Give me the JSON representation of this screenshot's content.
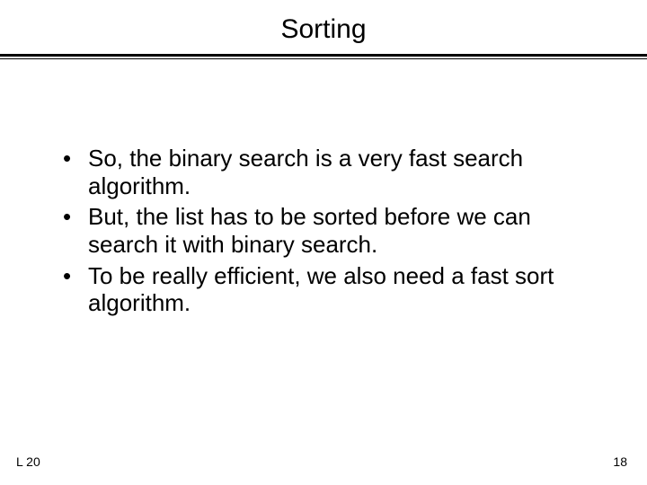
{
  "title": "Sorting",
  "bullets": [
    "So, the binary search is a very fast search algorithm.",
    "But, the list has to be sorted before we can search it with binary search.",
    "To be really efficient, we also need a fast sort algorithm."
  ],
  "footer": {
    "left": "L 20",
    "right": "18"
  },
  "bullet_symbol": "•"
}
